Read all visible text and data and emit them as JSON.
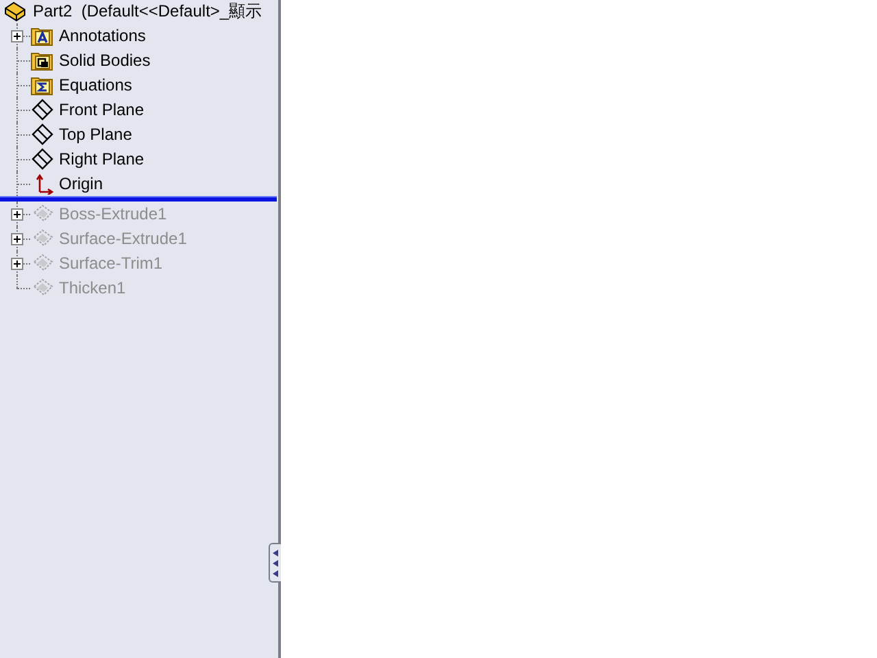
{
  "tree": {
    "root": {
      "label": "Part2  (Default<<Default>_顯示"
    },
    "items": [
      {
        "label": "Annotations",
        "kind": "annotations",
        "expandable": true,
        "rolled_back": false
      },
      {
        "label": "Solid Bodies",
        "kind": "bodies",
        "expandable": false,
        "rolled_back": false
      },
      {
        "label": "Equations",
        "kind": "equations",
        "expandable": false,
        "rolled_back": false
      },
      {
        "label": "Front Plane",
        "kind": "plane",
        "expandable": false,
        "rolled_back": false
      },
      {
        "label": "Top Plane",
        "kind": "plane",
        "expandable": false,
        "rolled_back": false
      },
      {
        "label": "Right Plane",
        "kind": "plane",
        "expandable": false,
        "rolled_back": false
      },
      {
        "label": "Origin",
        "kind": "origin",
        "expandable": false,
        "rolled_back": false
      },
      {
        "label": "Boss-Extrude1",
        "kind": "extrude",
        "expandable": true,
        "rolled_back": true
      },
      {
        "label": "Surface-Extrude1",
        "kind": "surface",
        "expandable": true,
        "rolled_back": true
      },
      {
        "label": "Surface-Trim1",
        "kind": "trim",
        "expandable": true,
        "rolled_back": true
      },
      {
        "label": "Thicken1",
        "kind": "thicken",
        "expandable": false,
        "rolled_back": true
      }
    ]
  }
}
